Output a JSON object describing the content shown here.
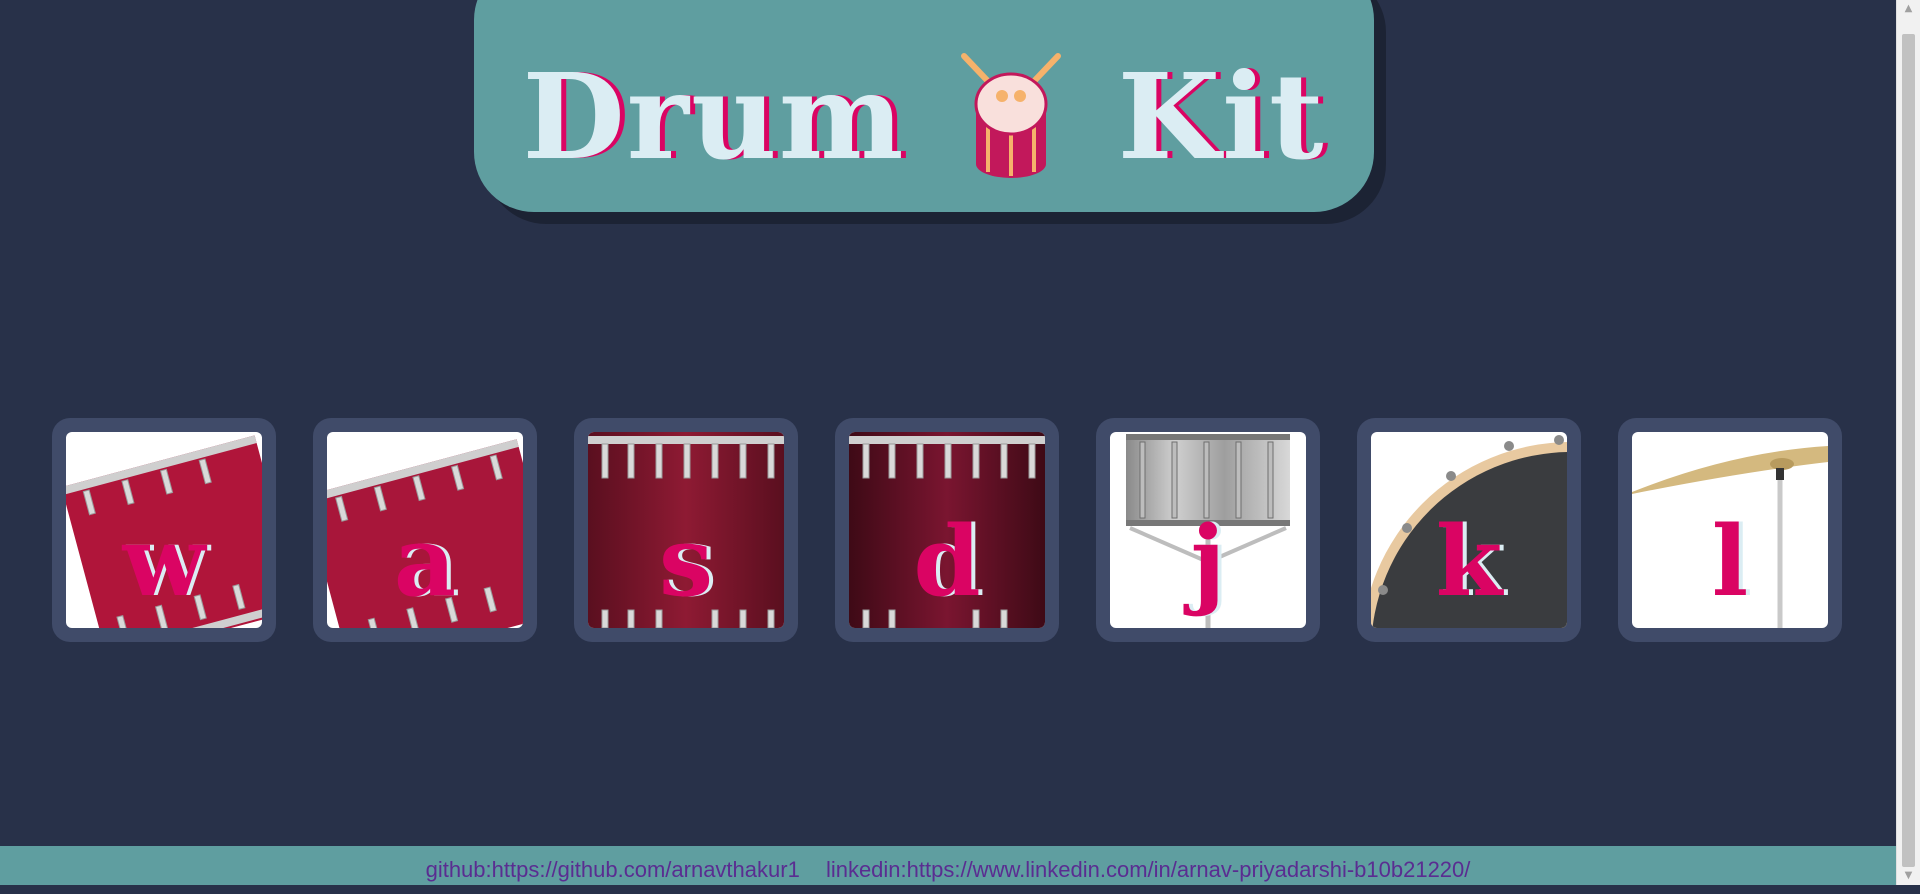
{
  "header": {
    "title_word_1": "Drum",
    "title_word_2": "Kit",
    "icon": "drum-icon"
  },
  "keys": [
    {
      "letter": "w",
      "instrument_icon": "tom-drum-icon"
    },
    {
      "letter": "a",
      "instrument_icon": "tom-drum-icon"
    },
    {
      "letter": "s",
      "instrument_icon": "tom-drum-icon"
    },
    {
      "letter": "d",
      "instrument_icon": "tom-drum-icon"
    },
    {
      "letter": "j",
      "instrument_icon": "snare-drum-icon"
    },
    {
      "letter": "k",
      "instrument_icon": "kick-drum-icon"
    },
    {
      "letter": "l",
      "instrument_icon": "cymbal-icon"
    }
  ],
  "footer": {
    "github": "github:https://github.com/arnavthakur1",
    "linkedin": "linkedin:https://www.linkedin.com/in/arnav-priyadarshi-b10b21220/"
  },
  "colors": {
    "background": "#283149",
    "header_bg": "#5f9ea0",
    "key_frame": "#404b69",
    "accent": "#da0463",
    "title_text": "#dbedf3",
    "link": "#5a2d91"
  }
}
